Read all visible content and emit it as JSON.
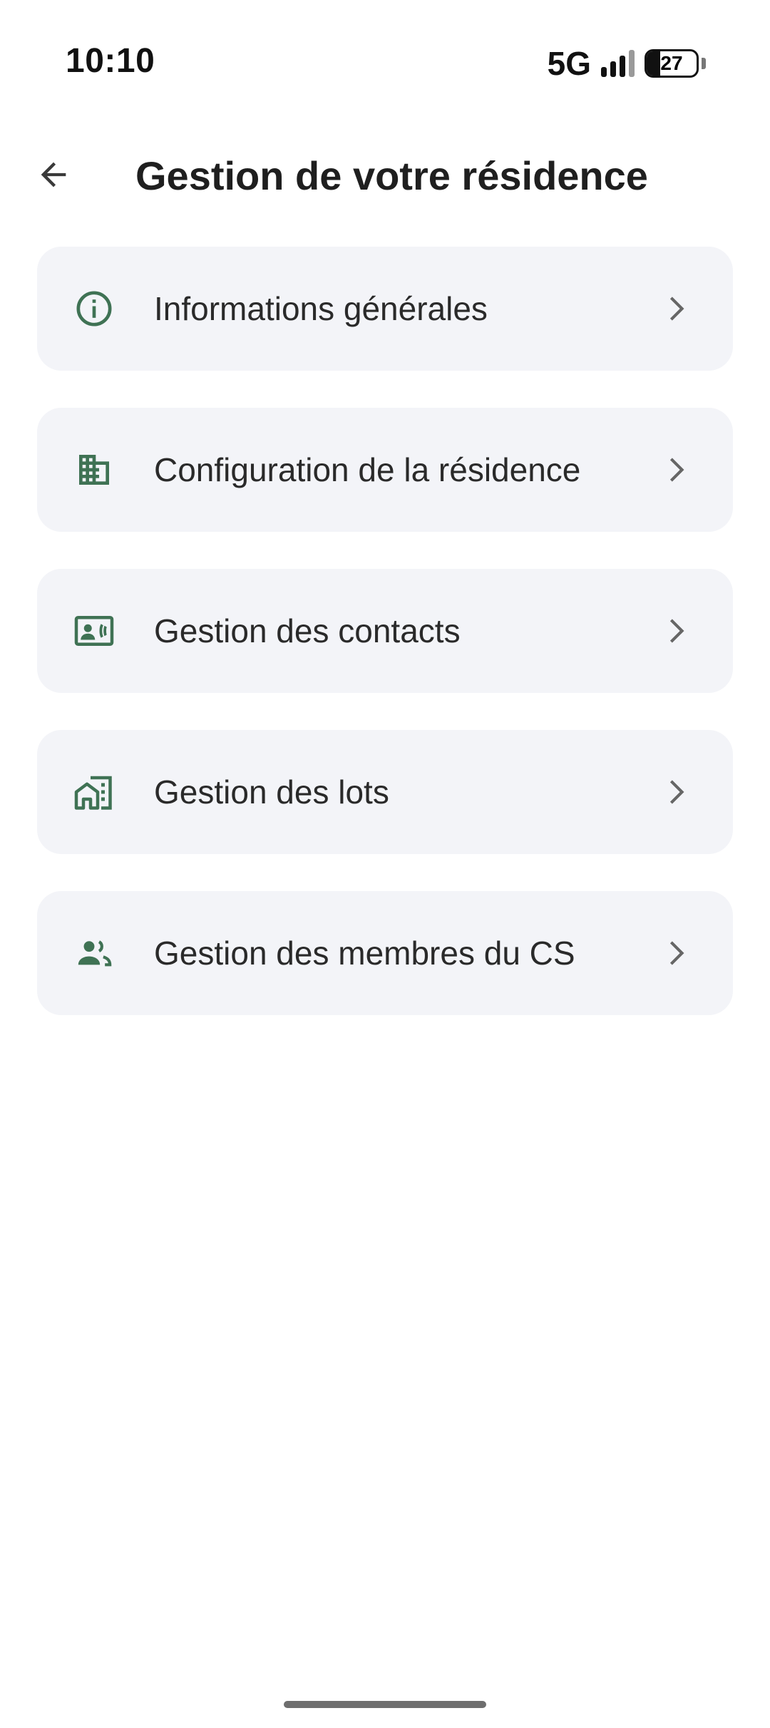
{
  "status_bar": {
    "time": "10:10",
    "network": "5G",
    "battery_level": "27",
    "battery_percent": 27,
    "signal_bars": 4
  },
  "header": {
    "title": "Gestion de votre résidence",
    "back_icon": "arrow-left-icon"
  },
  "menu": {
    "items": [
      {
        "label": "Informations générales",
        "icon": "info-icon"
      },
      {
        "label": "Configuration de la résidence",
        "icon": "building-icon"
      },
      {
        "label": "Gestion des contacts",
        "icon": "contact-card-icon"
      },
      {
        "label": "Gestion des lots",
        "icon": "home-work-icon"
      },
      {
        "label": "Gestion des membres du CS",
        "icon": "group-icon"
      }
    ],
    "chevron_icon": "chevron-right-icon"
  },
  "colors": {
    "accent": "#3f7254",
    "card_background": "#f3f4f8",
    "text": "#2a2a2a",
    "chevron": "#666666"
  }
}
